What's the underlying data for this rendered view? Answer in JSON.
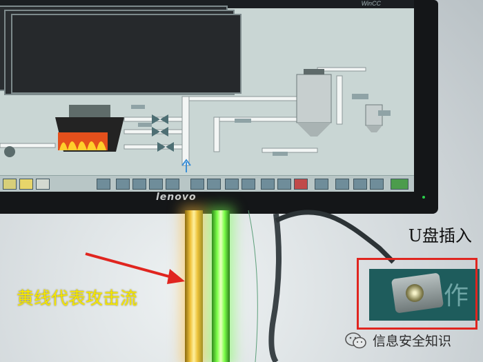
{
  "screen": {
    "window_label": "WinCC",
    "brand": "lenovo"
  },
  "annotations": {
    "usb_label": "U盘插入",
    "yellow_line_label": "黄线代表攻击流"
  },
  "watermark": {
    "text": "信息安全知识",
    "icon": "wechat-icon"
  },
  "colors": {
    "annotation_red": "#e0251f",
    "attack_yellow": "#f0c23a",
    "normal_green": "#7dff4a"
  }
}
